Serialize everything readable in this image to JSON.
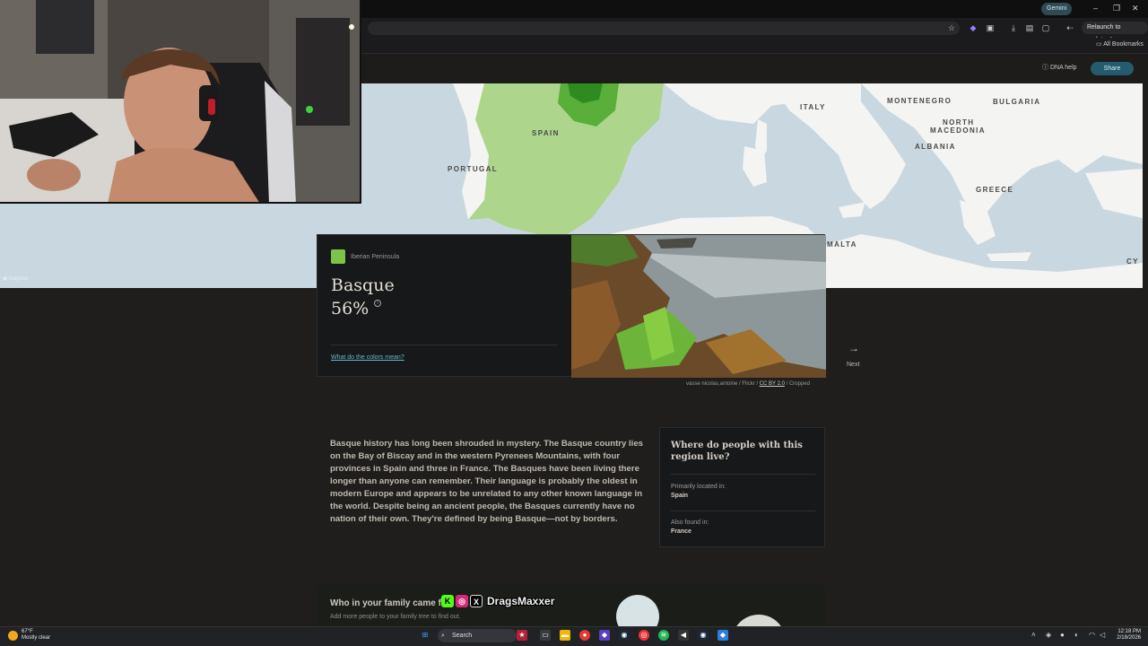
{
  "browser": {
    "gemini_label": "Gemini",
    "relaunch_label": "Relaunch to update",
    "all_bookmarks": "All Bookmarks",
    "minimize": "–",
    "maximize": "❐",
    "close": "✕"
  },
  "site_header": {
    "dna_help": "DNA help",
    "share": "Share"
  },
  "map": {
    "attribution": "mapbox",
    "labels": {
      "spain": "SPAIN",
      "portugal": "PORTUGAL",
      "italy": "ITALY",
      "montenegro": "MONTENEGRO",
      "bulgaria": "BULGARIA",
      "north": "NORTH",
      "macedonia": "MACEDONIA",
      "albania": "ALBANIA",
      "greece": "GREECE",
      "malta": "MALTA",
      "cyprus": "CY"
    }
  },
  "card": {
    "region": "Iberian Peninsula",
    "name": "Basque",
    "percent": "56%",
    "info": "i",
    "colors_link": "What do the colors mean?",
    "credit_prefix": "vasse nicolas,antoine / Flickr / ",
    "credit_license": "CC BY 2.0",
    "credit_suffix": " / Cropped"
  },
  "nav": {
    "next": "Next",
    "next_arrow": "→"
  },
  "history_text": "Basque history has long been shrouded in mystery. The Basque country lies on the Bay of Biscay and in the western Pyrenees Mountains, with four provinces in Spain and three in France. The Basques have been living there longer than anyone can remember. Their language is probably the oldest in modern Europe and appears to be unrelated to any other known language in the world. Despite being an ancient people, the Basques currently have no nation of their own. They're defined by being Basque—not by borders.",
  "where_live": {
    "heading": "Where do people with this region live?",
    "primary_label": "Primarily located in:",
    "primary_value": "Spain",
    "also_label": "Also found in:",
    "also_value": "France"
  },
  "family": {
    "heading": "Who in your family came f",
    "subtext": "Add more people to your family tree to find out."
  },
  "stream_overlay": {
    "handle": "DragsMaxxer",
    "kick": "K",
    "instagram": "◎",
    "x": "X"
  },
  "taskbar": {
    "temp": "67°F",
    "weather": "Mostly clear",
    "search": "Search",
    "time": "12:18 PM",
    "date": "2/18/2026"
  },
  "colors": {
    "accent_green": "#7dc24a",
    "map_water": "#c9d8e0",
    "share_button": "#245c6e",
    "link": "#6bb7cc"
  }
}
